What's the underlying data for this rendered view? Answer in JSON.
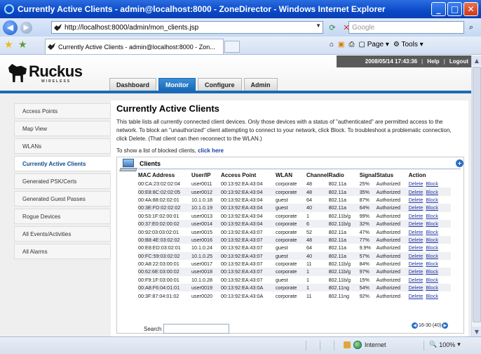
{
  "window": {
    "title": "Currently Active Clients - admin@localhost:8000 - ZoneDirector - Windows Internet Explorer"
  },
  "browser": {
    "url": "http://localhost:8000/admin/mon_clients.jsp",
    "search_placeholder": "Google",
    "tab_title": "Currently Active Clients - admin@localhost:8000 - Zon...",
    "page_label": "Page",
    "tools_label": "Tools"
  },
  "header": {
    "brand": "Ruckus",
    "brand_sub": "WIRELESS",
    "datetime": "2008/05/14 17:43:36",
    "help": "Help",
    "logout": "Logout",
    "tabs": [
      {
        "label": "Dashboard"
      },
      {
        "label": "Monitor"
      },
      {
        "label": "Configure"
      },
      {
        "label": "Admin"
      }
    ]
  },
  "sidebar": {
    "items": [
      {
        "label": "Access Points"
      },
      {
        "label": "Map View"
      },
      {
        "label": "WLANs"
      },
      {
        "label": "Currently Active Clients"
      },
      {
        "label": "Generated PSK/Certs"
      },
      {
        "label": "Generated Guest Passes"
      },
      {
        "label": "Rogue Devices"
      },
      {
        "label": "All Events/Activities"
      },
      {
        "label": "All Alarms"
      }
    ]
  },
  "main": {
    "title": "Currently Active Clients",
    "description": "This table lists all currently connected client devices. Only those devices with a status of \"authenticated\" are permitted access to the network. To block an \"unauthorized\" client attempting to connect to your network, click Block. To troubleshoot a problematic connection, click Delete. (That client can then reconnect to the WLAN.)",
    "blocked_text": "To show a list of blocked clients,",
    "blocked_link": "click here",
    "clients_label": "Clients",
    "columns": [
      "MAC Address",
      "User/IP",
      "Access Point",
      "WLAN",
      "Channel",
      "Radio",
      "Signal",
      "Status",
      "Action"
    ],
    "delete_label": "Delete",
    "block_label": "Block",
    "rows": [
      [
        "00:CA:23:02:02:04",
        "user0011",
        "00:13:92:EA:43:04",
        "corporate",
        "48",
        "802.11a",
        "25%",
        "Authorized"
      ],
      [
        "00:E8:8C:02:02:05",
        "user0012",
        "00:13:92:EA:43:04",
        "corporate",
        "48",
        "802.11a",
        "35%",
        "Authorized"
      ],
      [
        "00:4A:88:02:02:01",
        "10.1.0.18",
        "00:13:92:EA:43:04",
        "guest",
        "64",
        "802.11a",
        "87%",
        "Authorized"
      ],
      [
        "00:3E:FD:02:02:02",
        "10.1.0.19",
        "00:13:92:EA:43:04",
        "guest",
        "40",
        "802.11a",
        "64%",
        "Authorized"
      ],
      [
        "00:53:1F:02:00:01",
        "user0013",
        "00:13:92:EA:43:04",
        "corporate",
        "1",
        "802.11b/g",
        "99%",
        "Authorized"
      ],
      [
        "00:37:E0:02:00:02",
        "user0014",
        "00:13:92:EA:43:04",
        "corporate",
        "6",
        "802.11b/g",
        "32%",
        "Authorized"
      ],
      [
        "00:92:03:03:02:01",
        "user0015",
        "00:13:92:EA:43:07",
        "corporate",
        "52",
        "802.11a",
        "47%",
        "Authorized"
      ],
      [
        "00:B8:4E:03:02:02",
        "user0016",
        "00:13:92:EA:43:07",
        "corporate",
        "48",
        "802.11a",
        "77%",
        "Authorized"
      ],
      [
        "00:E8:ED:03:02:01",
        "10.1.0.24",
        "00:13:92:EA:43:07",
        "guest",
        "64",
        "802.11a",
        "9.9%",
        "Authorized"
      ],
      [
        "00:FC:59:03:02:02",
        "10.1.0.25",
        "00:13:92:EA:43:07",
        "guest",
        "40",
        "802.11a",
        "57%",
        "Authorized"
      ],
      [
        "00:A8:22:03:00:01",
        "user0017",
        "00:13:92:EA:43:07",
        "corporate",
        "11",
        "802.11b/g",
        "84%",
        "Authorized"
      ],
      [
        "00:62:6E:03:00:02",
        "user0018",
        "00:13:92:EA:43:07",
        "corporate",
        "1",
        "802.11b/g",
        "97%",
        "Authorized"
      ],
      [
        "00:F9:1F:03:00:01",
        "10.1.0.28",
        "00:13:92:EA:43:07",
        "guest",
        "1",
        "802.11b/g",
        "15%",
        "Authorized"
      ],
      [
        "00:A8:F6:04:01:01",
        "user0019",
        "00:13:92:EA:43:0A",
        "corporate",
        "1",
        "802.11ng",
        "54%",
        "Authorized"
      ],
      [
        "00:3F:87:04:01:02",
        "user0020",
        "00:13:92:EA:43:0A",
        "corporate",
        "11",
        "802.11ng",
        "92%",
        "Authorized"
      ]
    ],
    "search_label": "Search",
    "pager_text": "16-30 (40)"
  },
  "statusbar": {
    "zone": "Internet",
    "zoom": "100%"
  }
}
